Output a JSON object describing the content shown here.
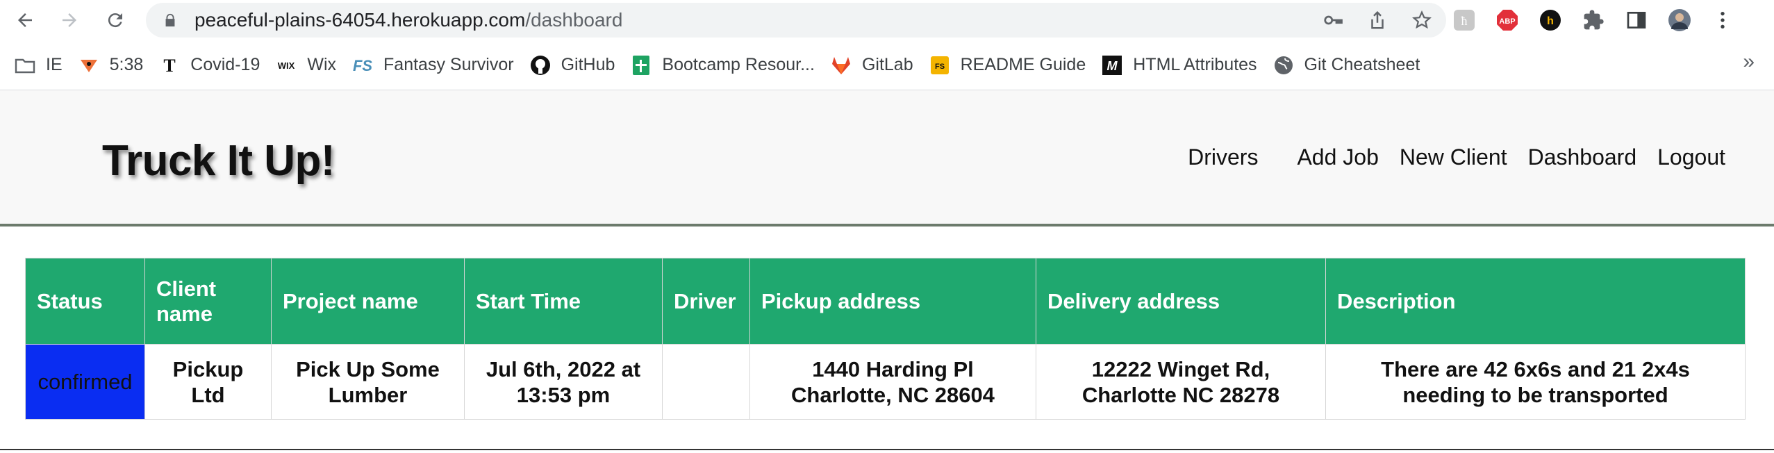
{
  "browser": {
    "url_host": "peaceful-plains-64054.herokuapp.com",
    "url_path": "/dashboard",
    "bookmarks": [
      {
        "label": "IE",
        "icon": "folder-icon"
      },
      {
        "label": "5:38",
        "icon": "runner-icon"
      },
      {
        "label": "Covid-19",
        "icon": "nyt-icon"
      },
      {
        "label": "Wix",
        "icon": "wix-icon"
      },
      {
        "label": "Fantasy Survivor",
        "icon": "fs-icon"
      },
      {
        "label": "GitHub",
        "icon": "github-icon"
      },
      {
        "label": "Bootcamp Resour...",
        "icon": "sheets-icon"
      },
      {
        "label": "GitLab",
        "icon": "gitlab-icon"
      },
      {
        "label": "README Guide",
        "icon": "readme-icon"
      },
      {
        "label": "HTML Attributes",
        "icon": "m-icon"
      },
      {
        "label": "Git Cheatsheet",
        "icon": "globe-icon"
      }
    ],
    "overflow_label": "»"
  },
  "site": {
    "brand": "Truck It Up!",
    "nav": [
      "Drivers",
      "Add Job",
      "New Client",
      "Dashboard",
      "Logout"
    ]
  },
  "table": {
    "headers": [
      "Status",
      "Client name",
      "Project name",
      "Start Time",
      "Driver",
      "Pickup address",
      "Delivery address",
      "Description"
    ],
    "rows": [
      {
        "status": "confirmed",
        "client_name": "Pickup Ltd",
        "project_name": "Pick Up Some Lumber",
        "start_time": "Jul 6th, 2022 at 13:53 pm",
        "driver": "",
        "pickup_address": "1440 Harding Pl Charlotte, NC 28604",
        "delivery_address": "12222 Winget Rd, Charlotte NC 28278",
        "description": "There are 42 6x6s and 21 2x4s needing to be transported"
      }
    ]
  },
  "colors": {
    "header_green": "#1fa86f",
    "status_blue": "#0a2df2"
  }
}
